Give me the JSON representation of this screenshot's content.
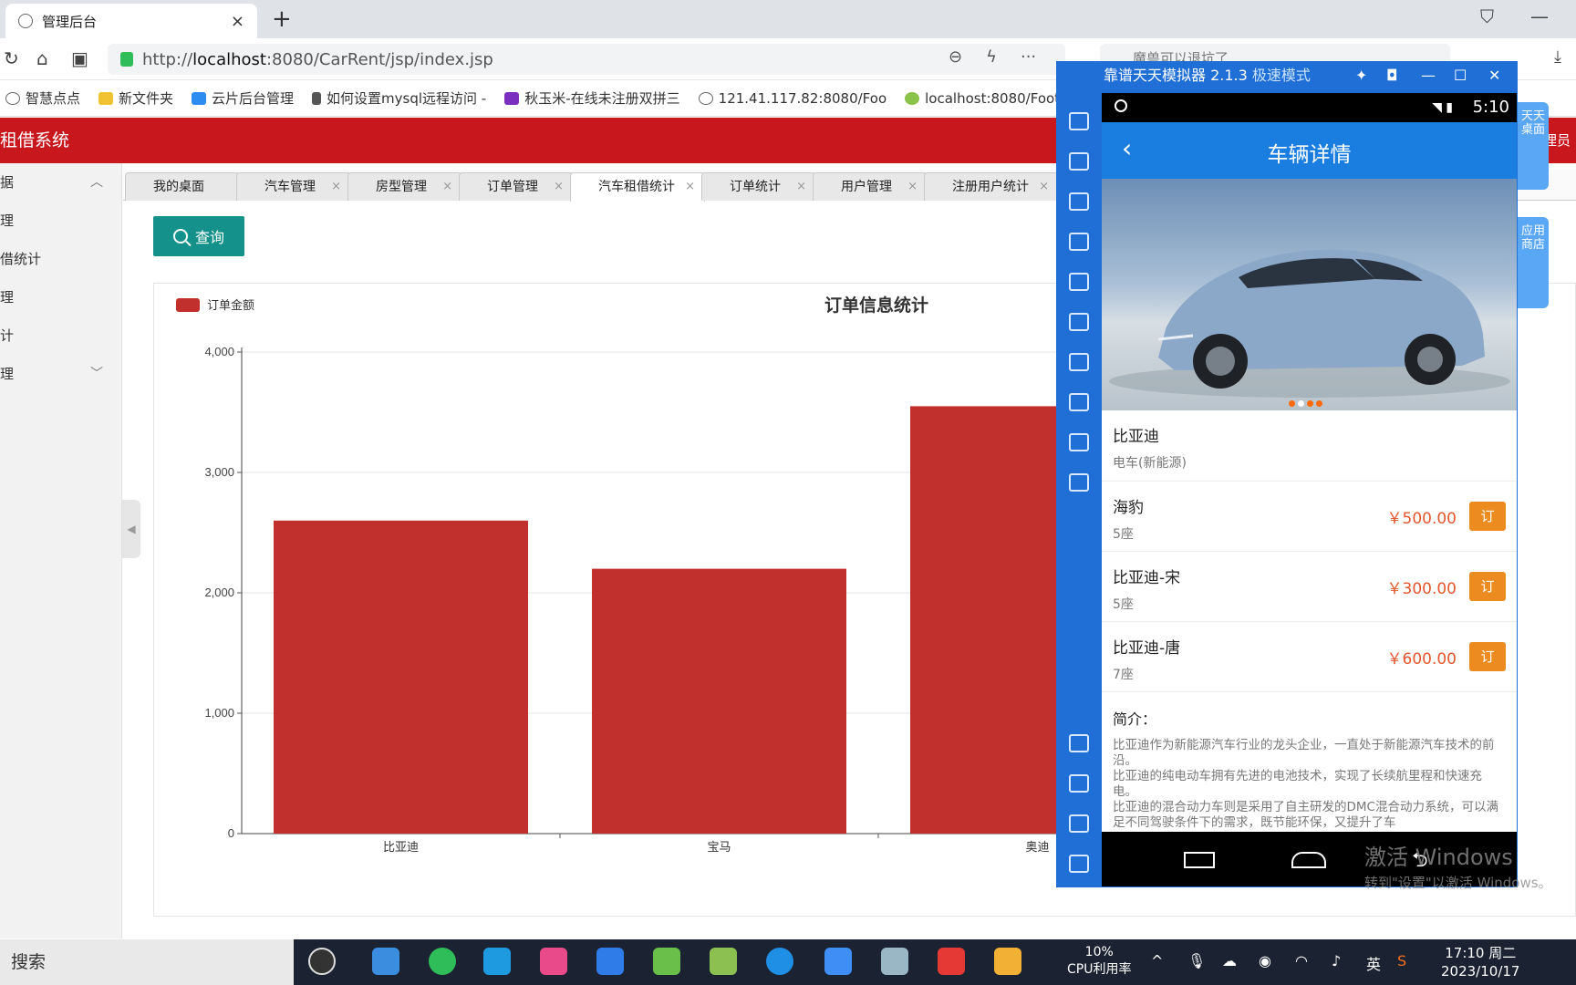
{
  "browser": {
    "tab_title": "管理后台",
    "url_prefix": "http://",
    "url_host": "localhost",
    "url_rest": ":8080/CarRent/jsp/index.jsp",
    "search_placeholder": "魔兽可以退坑了",
    "bookmarks": [
      "智慧点点",
      "新文件夹",
      "云片后台管理",
      "如何设置mysql远程访问 -",
      "秋玉米-在线未注册双拼三",
      "121.41.117.82:8080/Foo",
      "localhost:8080/FootE"
    ]
  },
  "app": {
    "title": "租借系统",
    "user": "理员",
    "sidebar": [
      "据",
      "理",
      "借统计",
      "理",
      "计",
      "理"
    ],
    "tabs": [
      "我的桌面",
      "汽车管理",
      "房型管理",
      "订单管理",
      "汽车租借统计",
      "订单统计",
      "用户管理",
      "注册用户统计"
    ],
    "active_tab": 4,
    "query_label": "查询",
    "colors": {
      "header": "#c8171d",
      "button": "#14918b",
      "bar": "#c1302d"
    }
  },
  "chart_data": {
    "type": "bar",
    "title": "订单信息统计",
    "legend": "订单金额",
    "legend_position": "top-left",
    "categories": [
      "比亚迪",
      "宝马",
      "奥迪"
    ],
    "values": [
      2600,
      2200,
      3550
    ],
    "ylim": [
      0,
      4000
    ],
    "yticks": [
      "0",
      "1,000",
      "2,000",
      "3,000",
      "4,000"
    ],
    "ytick_values": [
      0,
      1000,
      2000,
      3000,
      4000
    ],
    "grid": true
  },
  "emulator": {
    "title": "靠谱天天模拟器 2.1.3",
    "mode": "极速模式",
    "time": "5:10",
    "page_title": "车辆详情",
    "brand": "比亚迪",
    "brand_type": "电车(新能源)",
    "cars": [
      {
        "name": "海豹",
        "seats": "5座",
        "price": "￥500.00",
        "book": "订"
      },
      {
        "name": "比亚迪-宋",
        "seats": "5座",
        "price": "￥300.00",
        "book": "订"
      },
      {
        "name": "比亚迪-唐",
        "seats": "7座",
        "price": "￥600.00",
        "book": "订"
      }
    ],
    "intro_title": "简介：",
    "intro": [
      "比亚迪作为新能源汽车行业的龙头企业，一直处于新能源汽车技术的前沿。",
      "比亚迪的纯电动车拥有先进的电池技术，实现了长续航里程和快速充电。",
      "比亚迪的混合动力车则是采用了自主研发的DMC混合动力系统，可以满足不同驾驶条件下的需求，既节能环保，又提升了车"
    ],
    "side_tabs": [
      "天天桌面",
      "应用商店"
    ],
    "watermark_main": "激活 Windows",
    "watermark_sub": "转到\"设置\"以激活 Windows。"
  },
  "taskbar": {
    "search": "搜索",
    "cpu_value": "10%",
    "cpu_label": "CPU利用率",
    "ime": "英",
    "clock_time": "17:10 周二",
    "clock_date": "2023/10/17"
  }
}
